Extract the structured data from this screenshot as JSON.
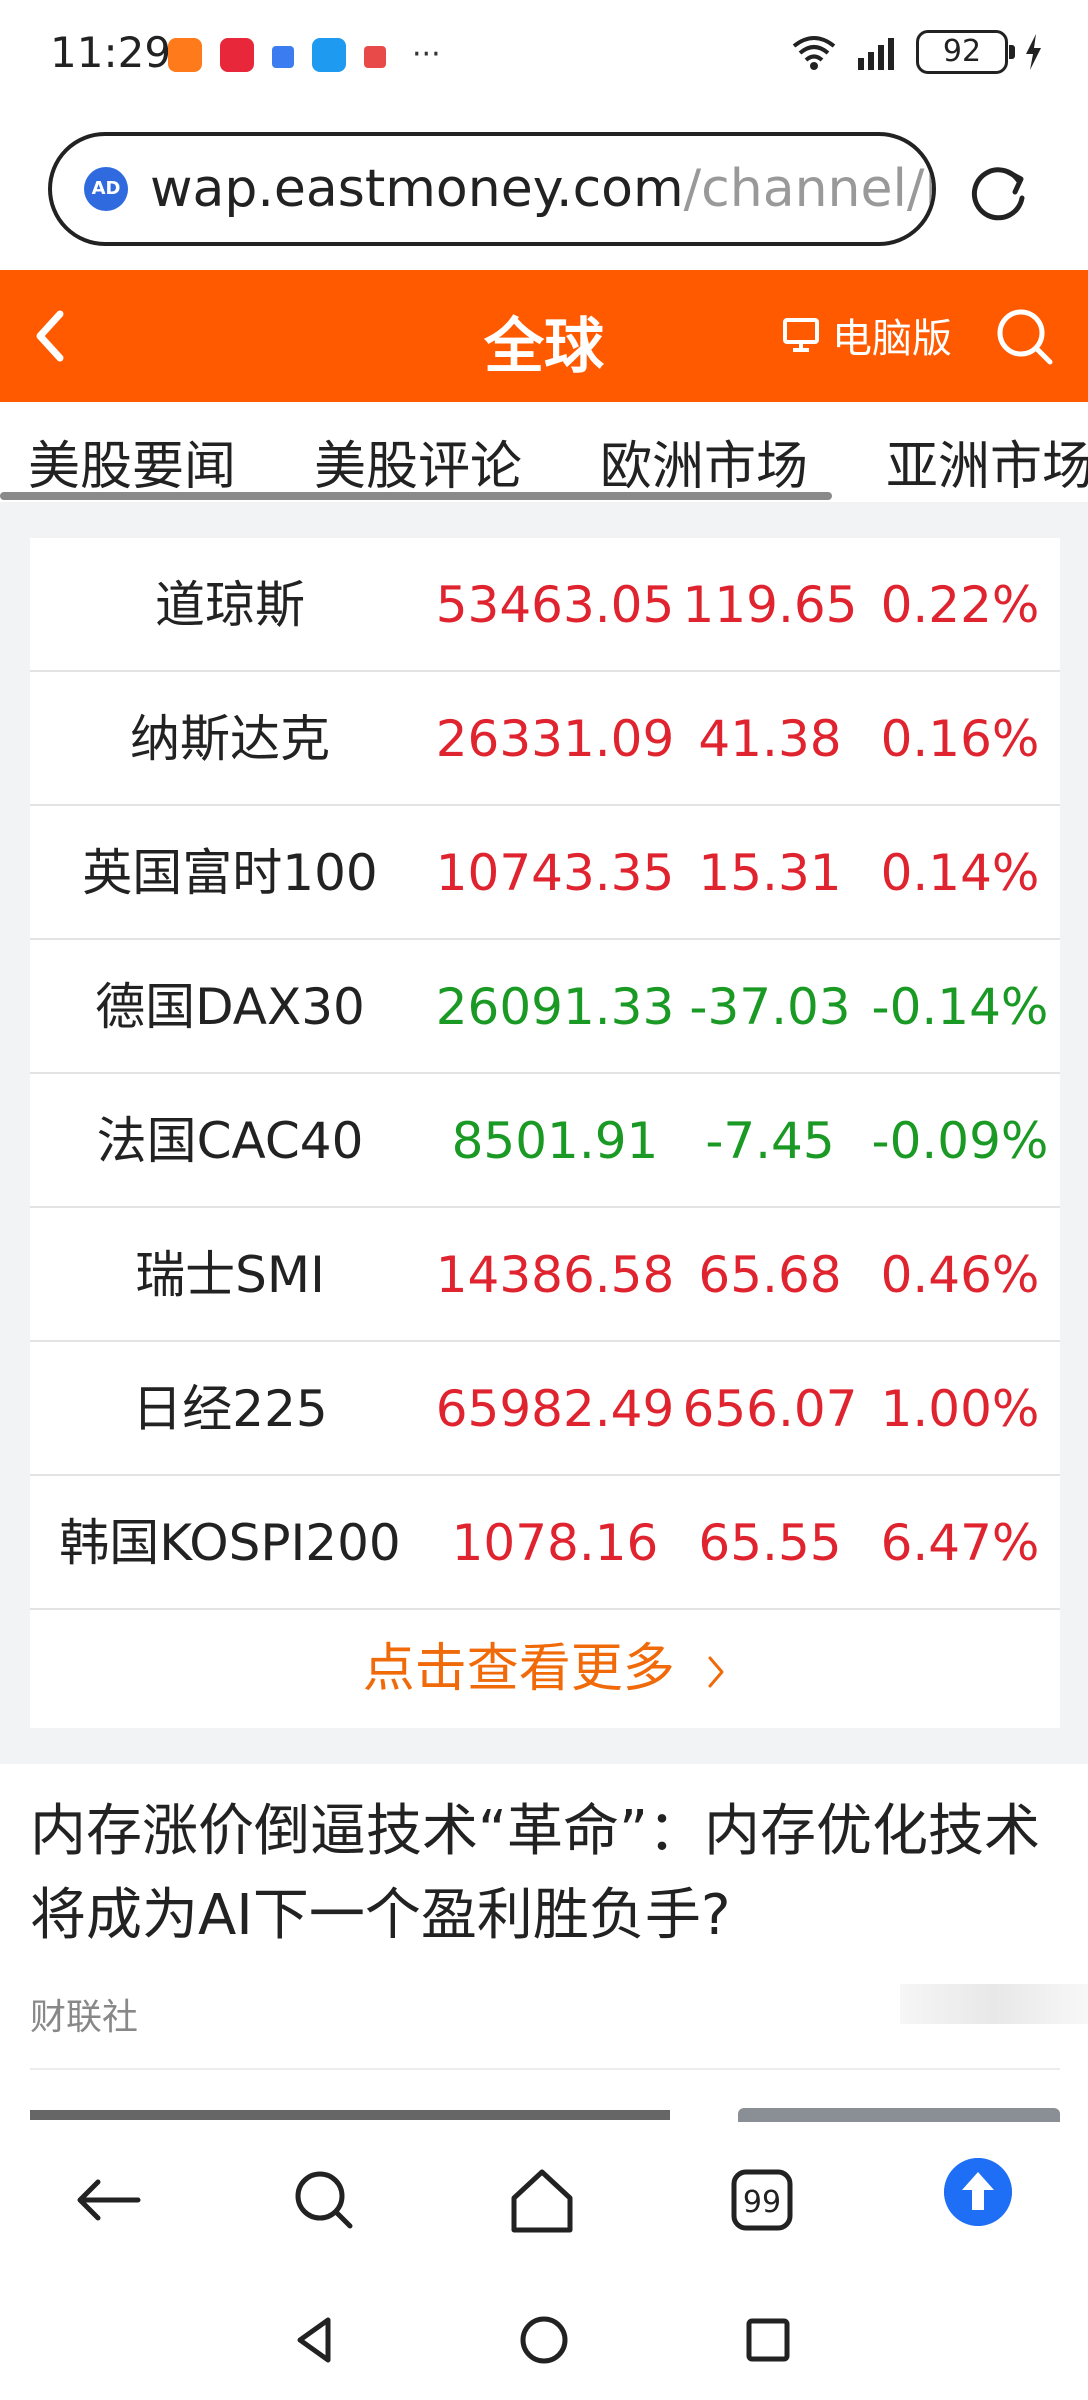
{
  "status_bar": {
    "time": "11:29",
    "notifications": [
      {
        "icon": "app-notification-icon",
        "color": "#ff7a1a"
      },
      {
        "icon": "app-notification-icon",
        "color": "#e8273a"
      },
      {
        "icon": "calendar-icon",
        "color": "#3b7cf0"
      },
      {
        "icon": "search-app-icon",
        "color": "#1e9bf0"
      },
      {
        "icon": "app-notification-icon",
        "color": "#e84a4a"
      }
    ],
    "more": "···",
    "battery": "92"
  },
  "browser": {
    "ad_badge": "AD",
    "url_host": "wap.eastmoney.com",
    "url_path": "/channel/lis"
  },
  "header": {
    "title": "全球",
    "desktop_label": "电脑版"
  },
  "tabs": [
    "美股要闻",
    "美股评论",
    "欧洲市场",
    "亚洲市场"
  ],
  "market": {
    "rows": [
      {
        "name": "道琼斯",
        "price": "53463.05",
        "change": "119.65",
        "percent": "0.22%",
        "trend": "up"
      },
      {
        "name": "纳斯达克",
        "price": "26331.09",
        "change": "41.38",
        "percent": "0.16%",
        "trend": "up"
      },
      {
        "name": "英国富时100",
        "price": "10743.35",
        "change": "15.31",
        "percent": "0.14%",
        "trend": "up"
      },
      {
        "name": "德国DAX30",
        "price": "26091.33",
        "change": "-37.03",
        "percent": "-0.14%",
        "trend": "down"
      },
      {
        "name": "法国CAC40",
        "price": "8501.91",
        "change": "-7.45",
        "percent": "-0.09%",
        "trend": "down"
      },
      {
        "name": "瑞士SMI",
        "price": "14386.58",
        "change": "65.68",
        "percent": "0.46%",
        "trend": "up"
      },
      {
        "name": "日经225",
        "price": "65982.49",
        "change": "656.07",
        "percent": "1.00%",
        "trend": "up"
      },
      {
        "name": "韩国KOSPI200",
        "price": "1078.16",
        "change": "65.55",
        "percent": "6.47%",
        "trend": "up"
      }
    ],
    "more_label": "点击查看更多"
  },
  "news": [
    {
      "title": "内存涨价倒逼技术“革命”：内存优化技术将成为AI下一个盈利胜负手?",
      "source": "财联社"
    }
  ],
  "colors": {
    "brand_orange": "#ff5a00",
    "up": "#e0242f",
    "down": "#1a9a24",
    "more_link": "#f06a0a",
    "accent_blue": "#1e6ff5"
  }
}
